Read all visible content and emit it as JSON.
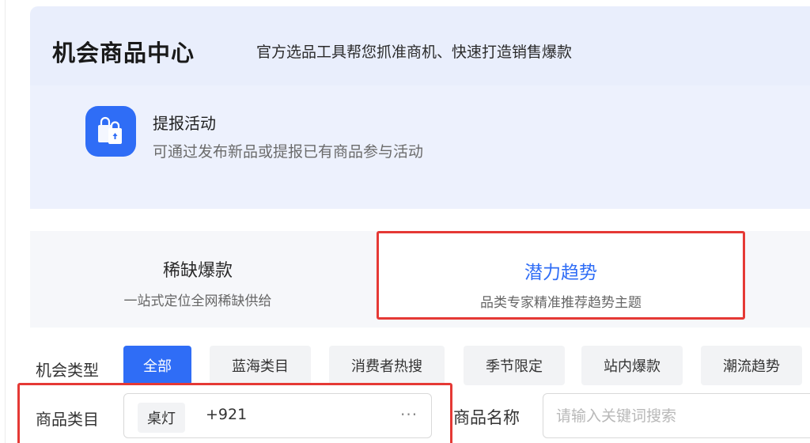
{
  "header": {
    "title": "机会商品中心",
    "subtitle": "官方选品工具帮您抓准商机、快速打造销售爆款"
  },
  "activity": {
    "icon": "shopping-bag-icon",
    "title": "提报活动",
    "description": "可通过发布新品或提报已有商品参与活动"
  },
  "tabs": [
    {
      "title": "稀缺爆款",
      "description": "一站式定位全网稀缺供给",
      "selected": false
    },
    {
      "title": "潜力趋势",
      "description": "品类专家精准推荐趋势主题",
      "selected": true
    }
  ],
  "filters": {
    "opportunity_type_label": "机会类型",
    "chips": [
      {
        "label": "全部",
        "active": true
      },
      {
        "label": "蓝海类目",
        "active": false
      },
      {
        "label": "消费者热搜",
        "active": false
      },
      {
        "label": "季节限定",
        "active": false
      },
      {
        "label": "站内爆款",
        "active": false
      },
      {
        "label": "潮流趋势",
        "active": false
      }
    ],
    "category_label": "商品类目",
    "category_tag": "桌灯",
    "category_more_count": "+921",
    "more_glyph": "···",
    "product_name_label": "商品名称",
    "product_name_placeholder": "请输入关键词搜索"
  },
  "colors": {
    "accent": "#2f6df6",
    "highlight_border": "#e53935",
    "header_bg": "#e9eefc"
  }
}
